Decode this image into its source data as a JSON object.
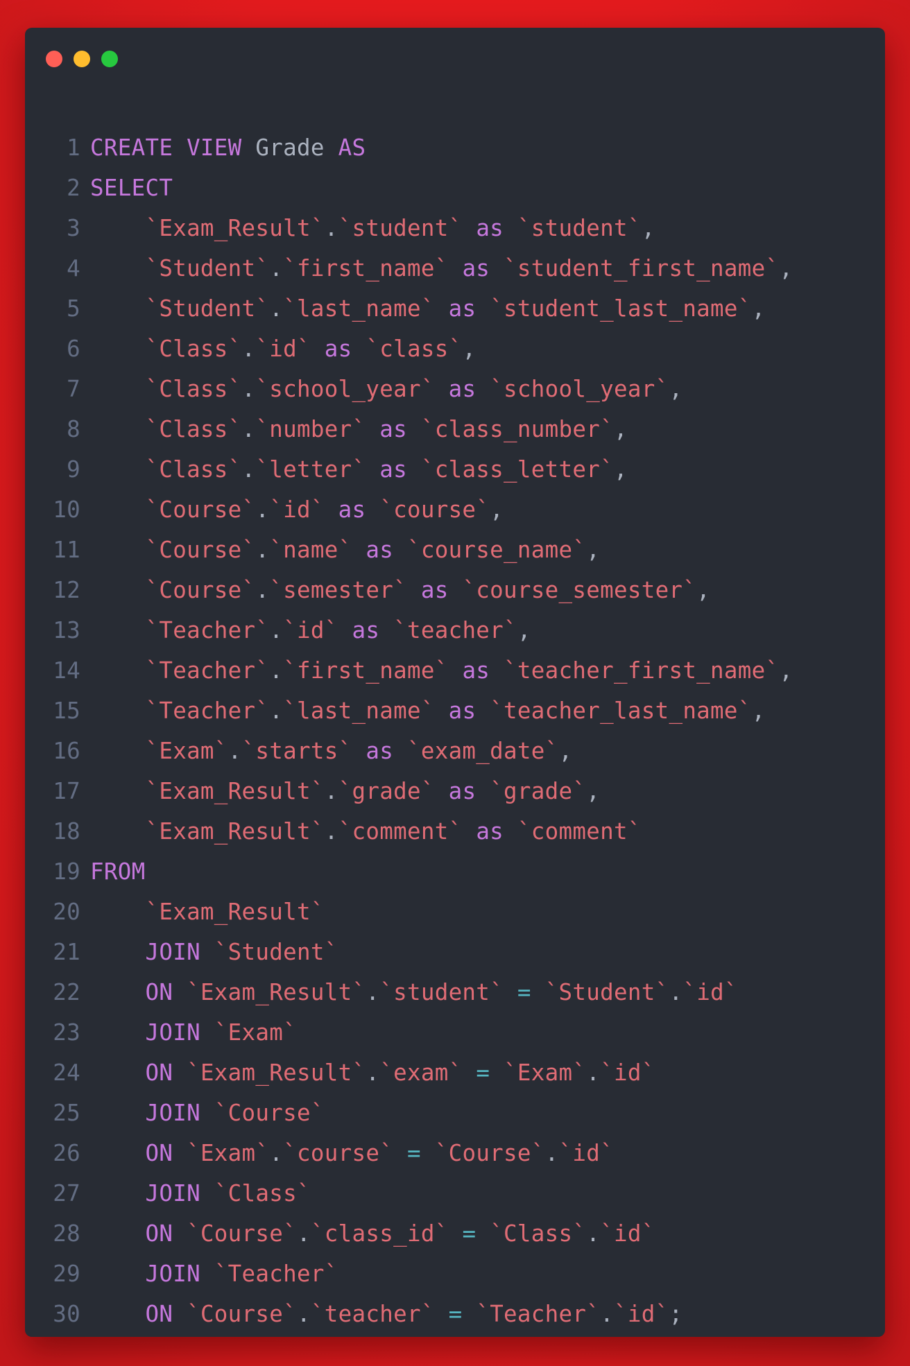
{
  "editor": {
    "window_controls": [
      {
        "name": "close",
        "color": "#ff5f56"
      },
      {
        "name": "minimize",
        "color": "#ffbd2e"
      },
      {
        "name": "maximize",
        "color": "#27c93f"
      }
    ],
    "colors": {
      "background": "#282c34",
      "frame": "#e31b1e",
      "keyword": "#c678dd",
      "identifier": "#e06c75",
      "plain": "#abb2bf",
      "operator": "#56b6c2",
      "line_number": "#636d83"
    },
    "lines": [
      [
        [
          "kw",
          "CREATE VIEW"
        ],
        [
          "plain",
          " Grade "
        ],
        [
          "kw",
          "AS"
        ]
      ],
      [
        [
          "kw",
          "SELECT"
        ]
      ],
      [
        [
          "plain",
          "    "
        ],
        [
          "id",
          "`Exam_Result`"
        ],
        [
          "plain",
          "."
        ],
        [
          "id",
          "`student`"
        ],
        [
          "plain",
          " "
        ],
        [
          "kw",
          "as"
        ],
        [
          "plain",
          " "
        ],
        [
          "id",
          "`student`"
        ],
        [
          "plain",
          ","
        ]
      ],
      [
        [
          "plain",
          "    "
        ],
        [
          "id",
          "`Student`"
        ],
        [
          "plain",
          "."
        ],
        [
          "id",
          "`first_name`"
        ],
        [
          "plain",
          " "
        ],
        [
          "kw",
          "as"
        ],
        [
          "plain",
          " "
        ],
        [
          "id",
          "`student_first_name`"
        ],
        [
          "plain",
          ","
        ]
      ],
      [
        [
          "plain",
          "    "
        ],
        [
          "id",
          "`Student`"
        ],
        [
          "plain",
          "."
        ],
        [
          "id",
          "`last_name`"
        ],
        [
          "plain",
          " "
        ],
        [
          "kw",
          "as"
        ],
        [
          "plain",
          " "
        ],
        [
          "id",
          "`student_last_name`"
        ],
        [
          "plain",
          ","
        ]
      ],
      [
        [
          "plain",
          "    "
        ],
        [
          "id",
          "`Class`"
        ],
        [
          "plain",
          "."
        ],
        [
          "id",
          "`id`"
        ],
        [
          "plain",
          " "
        ],
        [
          "kw",
          "as"
        ],
        [
          "plain",
          " "
        ],
        [
          "id",
          "`class`"
        ],
        [
          "plain",
          ","
        ]
      ],
      [
        [
          "plain",
          "    "
        ],
        [
          "id",
          "`Class`"
        ],
        [
          "plain",
          "."
        ],
        [
          "id",
          "`school_year`"
        ],
        [
          "plain",
          " "
        ],
        [
          "kw",
          "as"
        ],
        [
          "plain",
          " "
        ],
        [
          "id",
          "`school_year`"
        ],
        [
          "plain",
          ","
        ]
      ],
      [
        [
          "plain",
          "    "
        ],
        [
          "id",
          "`Class`"
        ],
        [
          "plain",
          "."
        ],
        [
          "id",
          "`number`"
        ],
        [
          "plain",
          " "
        ],
        [
          "kw",
          "as"
        ],
        [
          "plain",
          " "
        ],
        [
          "id",
          "`class_number`"
        ],
        [
          "plain",
          ","
        ]
      ],
      [
        [
          "plain",
          "    "
        ],
        [
          "id",
          "`Class`"
        ],
        [
          "plain",
          "."
        ],
        [
          "id",
          "`letter`"
        ],
        [
          "plain",
          " "
        ],
        [
          "kw",
          "as"
        ],
        [
          "plain",
          " "
        ],
        [
          "id",
          "`class_letter`"
        ],
        [
          "plain",
          ","
        ]
      ],
      [
        [
          "plain",
          "    "
        ],
        [
          "id",
          "`Course`"
        ],
        [
          "plain",
          "."
        ],
        [
          "id",
          "`id`"
        ],
        [
          "plain",
          " "
        ],
        [
          "kw",
          "as"
        ],
        [
          "plain",
          " "
        ],
        [
          "id",
          "`course`"
        ],
        [
          "plain",
          ","
        ]
      ],
      [
        [
          "plain",
          "    "
        ],
        [
          "id",
          "`Course`"
        ],
        [
          "plain",
          "."
        ],
        [
          "id",
          "`name`"
        ],
        [
          "plain",
          " "
        ],
        [
          "kw",
          "as"
        ],
        [
          "plain",
          " "
        ],
        [
          "id",
          "`course_name`"
        ],
        [
          "plain",
          ","
        ]
      ],
      [
        [
          "plain",
          "    "
        ],
        [
          "id",
          "`Course`"
        ],
        [
          "plain",
          "."
        ],
        [
          "id",
          "`semester`"
        ],
        [
          "plain",
          " "
        ],
        [
          "kw",
          "as"
        ],
        [
          "plain",
          " "
        ],
        [
          "id",
          "`course_semester`"
        ],
        [
          "plain",
          ","
        ]
      ],
      [
        [
          "plain",
          "    "
        ],
        [
          "id",
          "`Teacher`"
        ],
        [
          "plain",
          "."
        ],
        [
          "id",
          "`id`"
        ],
        [
          "plain",
          " "
        ],
        [
          "kw",
          "as"
        ],
        [
          "plain",
          " "
        ],
        [
          "id",
          "`teacher`"
        ],
        [
          "plain",
          ","
        ]
      ],
      [
        [
          "plain",
          "    "
        ],
        [
          "id",
          "`Teacher`"
        ],
        [
          "plain",
          "."
        ],
        [
          "id",
          "`first_name`"
        ],
        [
          "plain",
          " "
        ],
        [
          "kw",
          "as"
        ],
        [
          "plain",
          " "
        ],
        [
          "id",
          "`teacher_first_name`"
        ],
        [
          "plain",
          ","
        ]
      ],
      [
        [
          "plain",
          "    "
        ],
        [
          "id",
          "`Teacher`"
        ],
        [
          "plain",
          "."
        ],
        [
          "id",
          "`last_name`"
        ],
        [
          "plain",
          " "
        ],
        [
          "kw",
          "as"
        ],
        [
          "plain",
          " "
        ],
        [
          "id",
          "`teacher_last_name`"
        ],
        [
          "plain",
          ","
        ]
      ],
      [
        [
          "plain",
          "    "
        ],
        [
          "id",
          "`Exam`"
        ],
        [
          "plain",
          "."
        ],
        [
          "id",
          "`starts`"
        ],
        [
          "plain",
          " "
        ],
        [
          "kw",
          "as"
        ],
        [
          "plain",
          " "
        ],
        [
          "id",
          "`exam_date`"
        ],
        [
          "plain",
          ","
        ]
      ],
      [
        [
          "plain",
          "    "
        ],
        [
          "id",
          "`Exam_Result`"
        ],
        [
          "plain",
          "."
        ],
        [
          "id",
          "`grade`"
        ],
        [
          "plain",
          " "
        ],
        [
          "kw",
          "as"
        ],
        [
          "plain",
          " "
        ],
        [
          "id",
          "`grade`"
        ],
        [
          "plain",
          ","
        ]
      ],
      [
        [
          "plain",
          "    "
        ],
        [
          "id",
          "`Exam_Result`"
        ],
        [
          "plain",
          "."
        ],
        [
          "id",
          "`comment`"
        ],
        [
          "plain",
          " "
        ],
        [
          "kw",
          "as"
        ],
        [
          "plain",
          " "
        ],
        [
          "id",
          "`comment`"
        ]
      ],
      [
        [
          "kw",
          "FROM"
        ]
      ],
      [
        [
          "plain",
          "    "
        ],
        [
          "id",
          "`Exam_Result`"
        ]
      ],
      [
        [
          "plain",
          "    "
        ],
        [
          "kw",
          "JOIN"
        ],
        [
          "plain",
          " "
        ],
        [
          "id",
          "`Student`"
        ]
      ],
      [
        [
          "plain",
          "    "
        ],
        [
          "kw",
          "ON"
        ],
        [
          "plain",
          " "
        ],
        [
          "id",
          "`Exam_Result`"
        ],
        [
          "plain",
          "."
        ],
        [
          "id",
          "`student`"
        ],
        [
          "plain",
          " "
        ],
        [
          "op",
          "="
        ],
        [
          "plain",
          " "
        ],
        [
          "id",
          "`Student`"
        ],
        [
          "plain",
          "."
        ],
        [
          "id",
          "`id`"
        ]
      ],
      [
        [
          "plain",
          "    "
        ],
        [
          "kw",
          "JOIN"
        ],
        [
          "plain",
          " "
        ],
        [
          "id",
          "`Exam`"
        ]
      ],
      [
        [
          "plain",
          "    "
        ],
        [
          "kw",
          "ON"
        ],
        [
          "plain",
          " "
        ],
        [
          "id",
          "`Exam_Result`"
        ],
        [
          "plain",
          "."
        ],
        [
          "id",
          "`exam`"
        ],
        [
          "plain",
          " "
        ],
        [
          "op",
          "="
        ],
        [
          "plain",
          " "
        ],
        [
          "id",
          "`Exam`"
        ],
        [
          "plain",
          "."
        ],
        [
          "id",
          "`id`"
        ]
      ],
      [
        [
          "plain",
          "    "
        ],
        [
          "kw",
          "JOIN"
        ],
        [
          "plain",
          " "
        ],
        [
          "id",
          "`Course`"
        ]
      ],
      [
        [
          "plain",
          "    "
        ],
        [
          "kw",
          "ON"
        ],
        [
          "plain",
          " "
        ],
        [
          "id",
          "`Exam`"
        ],
        [
          "plain",
          "."
        ],
        [
          "id",
          "`course`"
        ],
        [
          "plain",
          " "
        ],
        [
          "op",
          "="
        ],
        [
          "plain",
          " "
        ],
        [
          "id",
          "`Course`"
        ],
        [
          "plain",
          "."
        ],
        [
          "id",
          "`id`"
        ]
      ],
      [
        [
          "plain",
          "    "
        ],
        [
          "kw",
          "JOIN"
        ],
        [
          "plain",
          " "
        ],
        [
          "id",
          "`Class`"
        ]
      ],
      [
        [
          "plain",
          "    "
        ],
        [
          "kw",
          "ON"
        ],
        [
          "plain",
          " "
        ],
        [
          "id",
          "`Course`"
        ],
        [
          "plain",
          "."
        ],
        [
          "id",
          "`class_id`"
        ],
        [
          "plain",
          " "
        ],
        [
          "op",
          "="
        ],
        [
          "plain",
          " "
        ],
        [
          "id",
          "`Class`"
        ],
        [
          "plain",
          "."
        ],
        [
          "id",
          "`id`"
        ]
      ],
      [
        [
          "plain",
          "    "
        ],
        [
          "kw",
          "JOIN"
        ],
        [
          "plain",
          " "
        ],
        [
          "id",
          "`Teacher`"
        ]
      ],
      [
        [
          "plain",
          "    "
        ],
        [
          "kw",
          "ON"
        ],
        [
          "plain",
          " "
        ],
        [
          "id",
          "`Course`"
        ],
        [
          "plain",
          "."
        ],
        [
          "id",
          "`teacher`"
        ],
        [
          "plain",
          " "
        ],
        [
          "op",
          "="
        ],
        [
          "plain",
          " "
        ],
        [
          "id",
          "`Teacher`"
        ],
        [
          "plain",
          "."
        ],
        [
          "id",
          "`id`"
        ],
        [
          "plain",
          ";"
        ]
      ]
    ]
  }
}
